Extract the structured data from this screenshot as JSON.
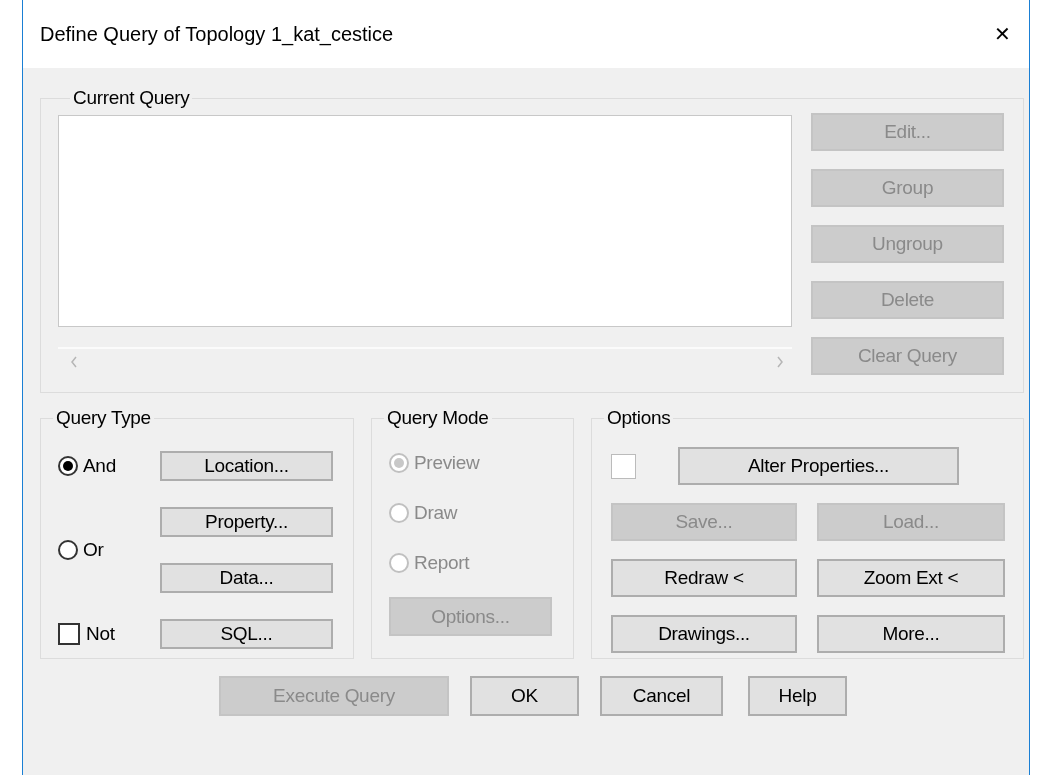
{
  "window": {
    "title": "Define Query of Topology 1_kat_cestice",
    "close": "✕"
  },
  "current_query": {
    "label": "Current Query",
    "buttons": [
      {
        "label": "Edit...",
        "disabled": true
      },
      {
        "label": "Group",
        "disabled": true
      },
      {
        "label": "Ungroup",
        "disabled": true
      },
      {
        "label": "Delete",
        "disabled": true
      },
      {
        "label": "Clear Query",
        "disabled": true
      }
    ]
  },
  "query_type": {
    "label": "Query Type",
    "options": [
      {
        "label": "And",
        "selected": true
      },
      {
        "label": "Or",
        "selected": false
      }
    ],
    "not": {
      "label": "Not",
      "checked": false
    },
    "buttons": [
      {
        "label": "Location...",
        "disabled": false
      },
      {
        "label": "Property...",
        "disabled": false
      },
      {
        "label": "Data...",
        "disabled": false
      },
      {
        "label": "SQL...",
        "disabled": false
      }
    ]
  },
  "query_mode": {
    "label": "Query Mode",
    "options": [
      {
        "label": "Preview",
        "selected": true,
        "disabled": true
      },
      {
        "label": "Draw",
        "selected": false,
        "disabled": true
      },
      {
        "label": "Report",
        "selected": false,
        "disabled": true
      }
    ],
    "button": {
      "label": "Options...",
      "disabled": true
    }
  },
  "options": {
    "label": "Options",
    "checkbox": {
      "checked": false
    },
    "alter": {
      "label": "Alter Properties...",
      "disabled": false
    },
    "buttons": [
      {
        "label": "Save...",
        "disabled": true
      },
      {
        "label": "Load...",
        "disabled": true
      },
      {
        "label": "Redraw <",
        "disabled": false
      },
      {
        "label": "Zoom Ext <",
        "disabled": false
      },
      {
        "label": "Drawings...",
        "disabled": false
      },
      {
        "label": "More...",
        "disabled": false
      }
    ]
  },
  "footer_buttons": [
    {
      "label": "Execute Query",
      "disabled": true
    },
    {
      "label": "OK",
      "disabled": false
    },
    {
      "label": "Cancel",
      "disabled": false
    },
    {
      "label": "Help",
      "disabled": false
    }
  ]
}
